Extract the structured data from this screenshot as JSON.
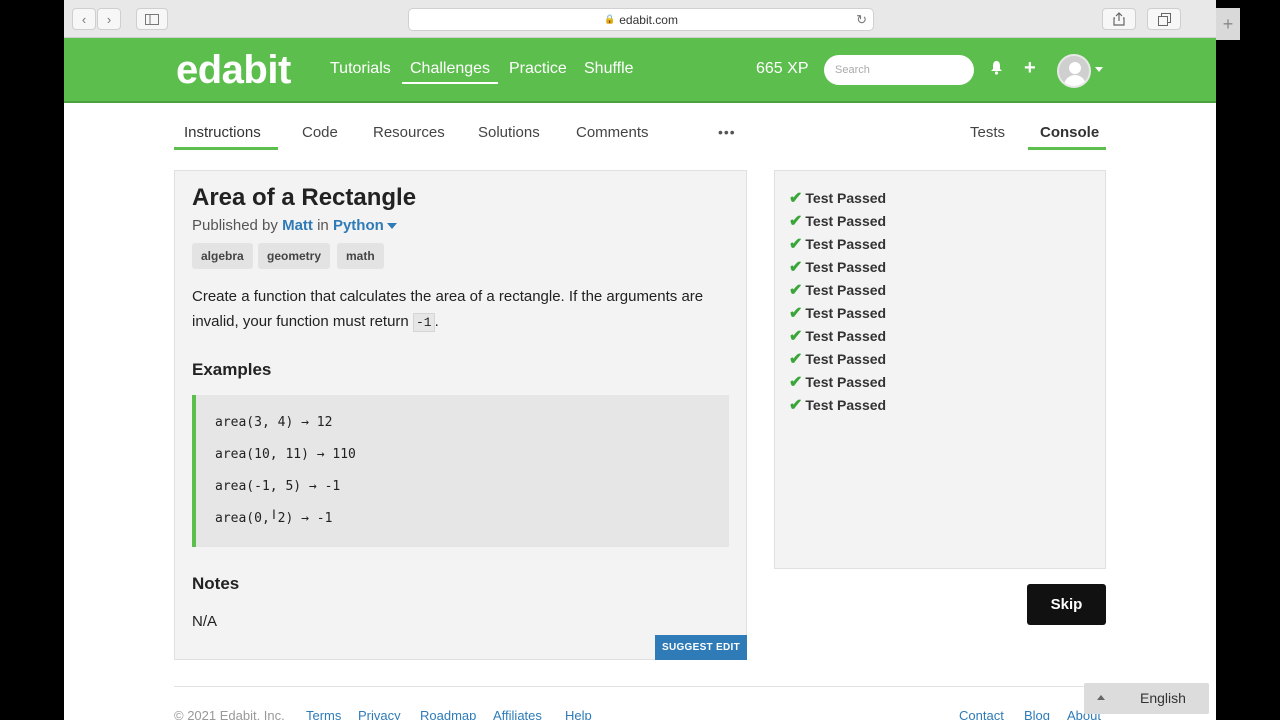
{
  "browser": {
    "url": "edabit.com"
  },
  "header": {
    "logo": "edabit",
    "nav": [
      "Tutorials",
      "Challenges",
      "Practice",
      "Shuffle"
    ],
    "active_nav": "Challenges",
    "xp": "665 XP",
    "search_placeholder": "Search"
  },
  "tabs": {
    "left": [
      "Instructions",
      "Code",
      "Resources",
      "Solutions",
      "Comments"
    ],
    "more": "•••",
    "right": [
      "Tests",
      "Console"
    ],
    "active_left": "Instructions",
    "active_right": "Console"
  },
  "challenge": {
    "title": "Area of a Rectangle",
    "published_prefix": "Published by",
    "author": "Matt",
    "in": "in",
    "language": "Python",
    "tags": [
      "algebra",
      "geometry",
      "math"
    ],
    "description_1": "Create a function that calculates the area of a rectangle. If the arguments are invalid, your function must return",
    "description_code": "-1",
    "description_end": ".",
    "examples_heading": "Examples",
    "examples": [
      "area(3, 4) → 12",
      "area(10, 11) → 110",
      "area(-1, 5) → -1",
      "area(0, 2) → -1"
    ],
    "notes_heading": "Notes",
    "notes": "N/A",
    "suggest_edit": "SUGGEST EDIT"
  },
  "console": {
    "results": [
      "Test Passed",
      "Test Passed",
      "Test Passed",
      "Test Passed",
      "Test Passed",
      "Test Passed",
      "Test Passed",
      "Test Passed",
      "Test Passed",
      "Test Passed"
    ]
  },
  "skip_label": "Skip",
  "footer": {
    "copyright": "© 2021 Edabit, Inc.",
    "links_left": [
      "Terms",
      "Privacy",
      "Roadmap",
      "Affiliates",
      "Help"
    ],
    "links_right": [
      "Contact",
      "Blog",
      "About"
    ]
  },
  "language_selector": "English",
  "colors": {
    "brand_green": "#5cbe4c",
    "link_blue": "#2e7bb8"
  }
}
